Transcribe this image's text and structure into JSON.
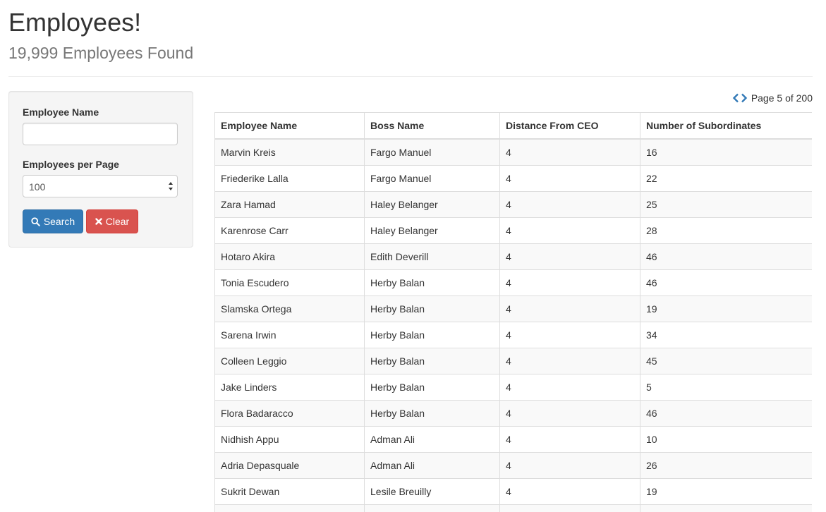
{
  "header": {
    "title": "Employees!",
    "subtitle": "19,999 Employees Found"
  },
  "search": {
    "name_label": "Employee Name",
    "name_value": "",
    "name_placeholder": "",
    "per_page_label": "Employees per Page",
    "per_page_value": "100",
    "search_button": "Search",
    "clear_button": "Clear"
  },
  "pagination": {
    "label": "Page 5 of 200",
    "current_page": 5,
    "total_pages": 200
  },
  "table": {
    "columns": [
      "Employee Name",
      "Boss Name",
      "Distance From CEO",
      "Number of Subordinates"
    ],
    "rows": [
      [
        "Marvin Kreis",
        "Fargo Manuel",
        "4",
        "16"
      ],
      [
        "Friederike Lalla",
        "Fargo Manuel",
        "4",
        "22"
      ],
      [
        "Zara Hamad",
        "Haley Belanger",
        "4",
        "25"
      ],
      [
        "Karenrose Carr",
        "Haley Belanger",
        "4",
        "28"
      ],
      [
        "Hotaro Akira",
        "Edith Deverill",
        "4",
        "46"
      ],
      [
        "Tonia Escudero",
        "Herby Balan",
        "4",
        "46"
      ],
      [
        "Slamska Ortega",
        "Herby Balan",
        "4",
        "19"
      ],
      [
        "Sarena Irwin",
        "Herby Balan",
        "4",
        "34"
      ],
      [
        "Colleen Leggio",
        "Herby Balan",
        "4",
        "45"
      ],
      [
        "Jake Linders",
        "Herby Balan",
        "4",
        "5"
      ],
      [
        "Flora Badaracco",
        "Herby Balan",
        "4",
        "46"
      ],
      [
        "Nidhish Appu",
        "Adman Ali",
        "4",
        "10"
      ],
      [
        "Adria Depasquale",
        "Adman Ali",
        "4",
        "26"
      ],
      [
        "Sukrit Dewan",
        "Lesile Breuilly",
        "4",
        "19"
      ],
      [
        "",
        "",
        "",
        ""
      ]
    ]
  },
  "colors": {
    "primary": "#337ab7",
    "danger": "#d9534f",
    "muted_text": "#777777",
    "stripe": "#f9f9f9",
    "border": "#dddddd"
  },
  "icons": {
    "search": "search-icon",
    "clear": "close-icon",
    "prev": "chevron-left-icon",
    "next": "chevron-right-icon"
  }
}
